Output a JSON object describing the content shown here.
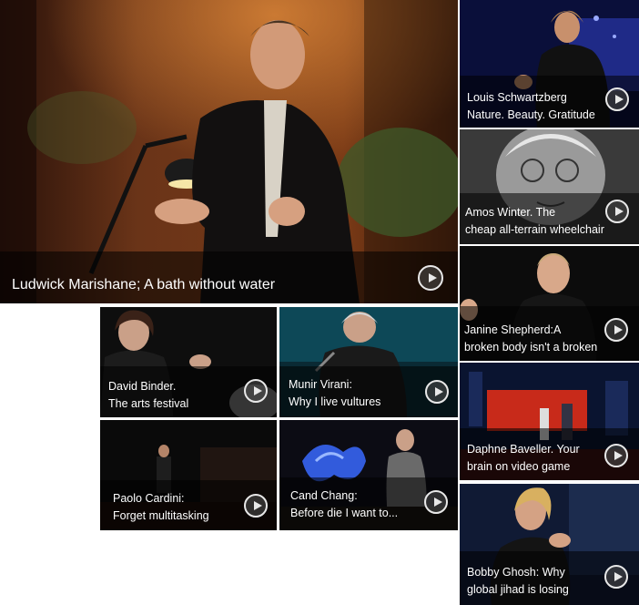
{
  "hero": {
    "title": "Ludwick Marishane; A bath without water",
    "play_icon": "play-icon"
  },
  "side_tiles": [
    {
      "line1": "Louis Schwartzberg",
      "line2": "Nature. Beauty. Gratitude"
    },
    {
      "line1": "Amos Winter. The",
      "line2": "cheap all-terrain wheelchair"
    },
    {
      "line1": "Janine Shepherd:A",
      "line2": "broken body isn't a broken"
    },
    {
      "line1": "Daphne Baveller. Your",
      "line2": "brain on video game"
    },
    {
      "line1": "Bobby Ghosh: Why",
      "line2": "global jihad is losing"
    }
  ],
  "grid_tiles": [
    {
      "line1": "David Binder.",
      "line2": "The arts festival"
    },
    {
      "line1": "Munir Virani:",
      "line2": "Why I live vultures"
    },
    {
      "line1": "Paolo Cardini:",
      "line2": "Forget multitasking"
    },
    {
      "line1": "Cand Chang:",
      "line2": "Before die I want to..."
    }
  ],
  "colors": {
    "caption_bg": "rgba(0,0,0,0.55)",
    "caption_text": "#ffffff",
    "page_bg": "#ffffff"
  }
}
